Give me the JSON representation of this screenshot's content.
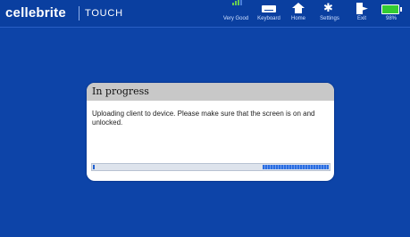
{
  "brand": {
    "name": "cellebrite",
    "product": "TOUCH"
  },
  "toolbar": {
    "signal_label": "Very Good",
    "signal_icon": "signal-bars-icon",
    "keyboard_label": "Keyboard",
    "keyboard_icon": "keyboard-icon",
    "home_label": "Home",
    "home_icon": "home-icon",
    "settings_label": "Settings",
    "settings_icon": "gear-icon",
    "exit_label": "Exit",
    "exit_icon": "exit-icon",
    "battery_label": "98%",
    "battery_icon": "battery-icon",
    "battery_level": 0.98
  },
  "dialog": {
    "title": "In progress",
    "message": "Uploading client to device. Please make sure that the screen is on and unlocked.",
    "progress_indeterminate_fraction": 0.28
  },
  "colors": {
    "background": "#0d44a8",
    "dialog_header": "#c8c8c8",
    "progress_fill": "#2b6ee0",
    "battery": "#33cc33",
    "signal": "#66cc55"
  }
}
